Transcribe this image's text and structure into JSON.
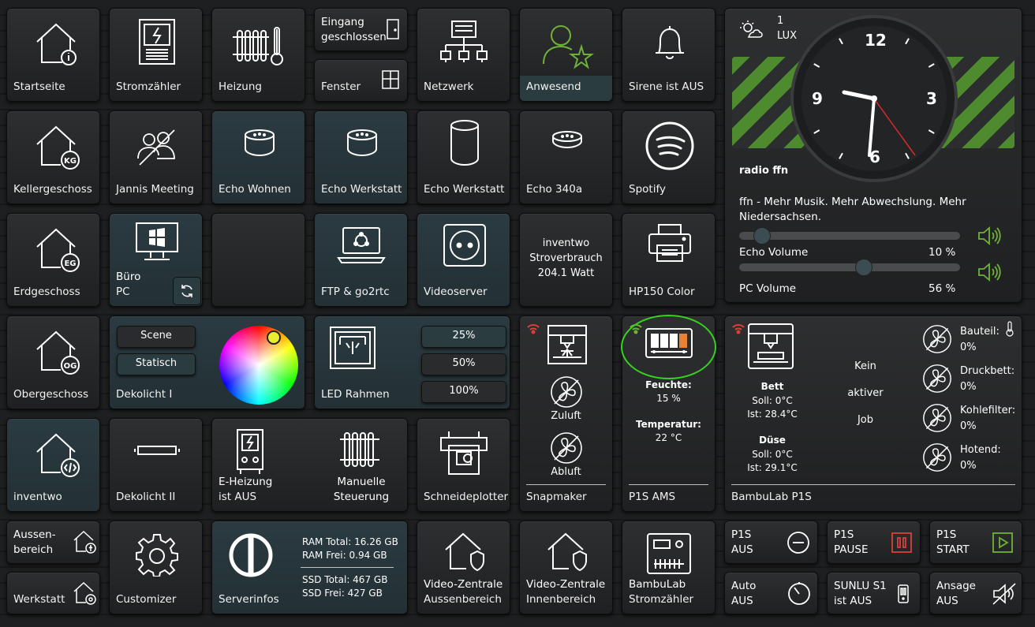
{
  "tiles": {
    "startseite": "Startseite",
    "stromzaehler": "Stromzähler",
    "heizung": "Heizung",
    "eingang": "Eingang geschlossen",
    "fenster": "Fenster",
    "netzwerk": "Netzwerk",
    "anwesend": "Anwesend",
    "sirene": "Sirene ist AUS",
    "kellergeschoss": "Kellergeschoss",
    "jannis_meeting": "Jannis Meeting",
    "echo_wohnen": "Echo Wohnen",
    "echo_werkstatt1": "Echo Werkstatt",
    "echo_werkstatt2": "Echo Werkstatt",
    "echo_340a": "Echo 340a",
    "spotify": "Spotify",
    "erdgeschoss": "Erdgeschoss",
    "buero_pc_1": "Büro",
    "buero_pc_2": "PC",
    "ftp": "FTP & go2rtc",
    "videoserver": "Videoserver",
    "inventwo_title": "inventwo",
    "inventwo_line2": "Stroverbrauch",
    "inventwo_value": "204.1 Watt",
    "hp150": "HP150 Color",
    "obergeschoss": "Obergeschoss",
    "dekolicht1": "Dekolicht I",
    "scene": "Scene",
    "statisch": "Statisch",
    "led_rahmen": "LED Rahmen",
    "led_25": "25%",
    "led_50": "50%",
    "led_100": "100%",
    "inventwo": "inventwo",
    "dekolicht2": "Dekolicht II",
    "eheizung_1": "E-Heizung",
    "eheizung_2": "ist AUS",
    "manuelle_1": "Manuelle",
    "manuelle_2": "Steuerung",
    "schneideplotter": "Schneideplotter",
    "snapmaker": "Snapmaker",
    "zuluft": "Zuluft",
    "abluft": "Abluft",
    "p1s_ams": "P1S AMS",
    "feuchte_label": "Feuchte:",
    "feuchte_value": "15 %",
    "temperatur_label": "Temperatur:",
    "temperatur_value": "22 °C",
    "bambulab_p1s": "BambuLab P1S",
    "bett": "Bett",
    "bett_soll": "Soll: 0°C",
    "bett_ist": "Ist: 28.4°C",
    "duese": "Düse",
    "duese_soll": "Soll: 0°C",
    "duese_ist": "Ist: 29.1°C",
    "kein": "Kein",
    "aktiver": "aktiver",
    "job": "Job",
    "bauteil": "Bauteil:",
    "bauteil_value": "0%",
    "druckbett": "Druckbett:",
    "druckbett_value": "0%",
    "kohlefilter": "Kohlefilter:",
    "kohlefilter_value": "0%",
    "hotend": "Hotend:",
    "hotend_value": "0%",
    "aussen_1": "Aussen-",
    "aussen_2": "bereich",
    "werkstatt": "Werkstatt",
    "customizer": "Customizer",
    "serverinfos": "Serverinfos",
    "ram_total": "RAM Total: 16.26 GB",
    "ram_frei": "RAM Frei: 0.94 GB",
    "ssd_total": "SSD Total: 467 GB",
    "ssd_frei": "SSD Frei: 427 GB",
    "vz_aussen_1": "Video-Zentrale",
    "vz_aussen_2": "Aussenbereich",
    "vz_innen_1": "Video-Zentrale",
    "vz_innen_2": "Innenbereich",
    "bambu_strom_1": "BambuLab",
    "bambu_strom_2": "Stromzähler",
    "p1s_aus_1": "P1S",
    "p1s_aus_2": "AUS",
    "p1s_pause_1": "P1S",
    "p1s_pause_2": "PAUSE",
    "p1s_start_1": "P1S",
    "p1s_start_2": "START",
    "auto_aus_1": "Auto",
    "auto_aus_2": "AUS",
    "sunlu_1": "SUNLU S1",
    "sunlu_2": "ist AUS",
    "ansage_1": "Ansage",
    "ansage_2": "AUS"
  },
  "media": {
    "lux_value": "1",
    "lux_unit": "LUX",
    "clock_12": "12",
    "clock_3": "3",
    "clock_6": "6",
    "clock_9": "9",
    "station": "radio ffn",
    "description": "ffn - Mehr Musik. Mehr Abwechslung. Mehr Niedersachsen.",
    "echo_volume_label": "Echo Volume",
    "echo_volume_value": "10 %",
    "pc_volume_label": "PC Volume",
    "pc_volume_value": "56 %",
    "echo_volume_level": 0.1,
    "pc_volume_level": 0.56
  },
  "colors": {
    "accent_green": "#6fb23a",
    "stripe_green": "#4d8b2e",
    "wifi_red": "#d9403a",
    "annotation_green": "#36d11f",
    "pause_red": "#d9403a"
  }
}
